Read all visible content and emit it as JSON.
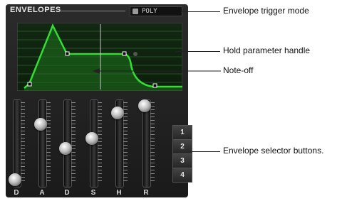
{
  "panel": {
    "title": "ENVELOPES",
    "mode_display": "POLY"
  },
  "envelope": {
    "stage_labels": [
      "D",
      "A",
      "D",
      "S",
      "H",
      "R"
    ],
    "slider_levels": [
      0.05,
      0.7,
      0.45,
      0.55,
      0.85,
      0.92
    ]
  },
  "selector_buttons": [
    "1",
    "2",
    "3",
    "4"
  ],
  "callouts": {
    "trigger_mode": "Envelope trigger mode",
    "hold_handle": "Hold parameter handle",
    "note_off": "Note-off",
    "selector": "Envelope selector buttons."
  },
  "colors": {
    "panel_bg": "#222222",
    "display_bg": "#1e4a22",
    "envelope_green": "#33dd33"
  }
}
